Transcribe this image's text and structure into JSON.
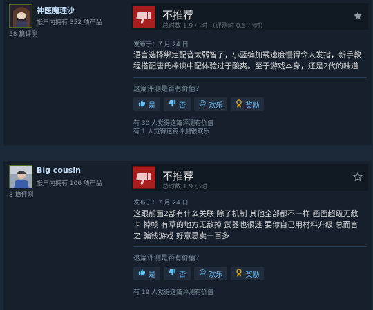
{
  "reviews": [
    {
      "author": {
        "name": "神医魔理沙",
        "products": "帐户内拥有 352 项产品",
        "review_count": "58 篇评测"
      },
      "verdict": "不推荐",
      "hours": "总时数 1.9 小时   （评测时 0.5 小时）",
      "posted": "发布于：7 月 24 日",
      "body": "语言选择绑定配音太弱智了，小蓝编加载速度慢得令人发指，新手教\n程搭配唐氏棒读中配体验过于酸爽。至于游戏本身，还是2代的味道",
      "helpful_question": "这篇评测是否有价值？",
      "buttons": {
        "yes": "是",
        "no": "否",
        "funny": "欢乐",
        "award": "奖励"
      },
      "stats": [
        "有 30 人觉得这篇评测有价值",
        "有 1 人觉得这篇评测很欢乐"
      ],
      "favorited": true
    },
    {
      "author": {
        "name": "Big cousin",
        "products": "帐户内拥有 106 项产品",
        "review_count": "8 篇评测"
      },
      "verdict": "不推荐",
      "hours": "总时数 1.9 小时",
      "posted": "发布于：7 月 24 日",
      "body": "这跟前面2部有什么关联 除了机制 其他全部都不一样 画面超级无敌\n卡 掉帧 有草的地方无敌掉 武器也很迷 要你自己用材料升级 总而言\n之 骗钱游戏 好意思卖一百多",
      "helpful_question": "这篇评测是否有价值？",
      "buttons": {
        "yes": "是",
        "no": "否",
        "funny": "欢乐",
        "award": "奖励"
      },
      "stats": [
        "有 19 人觉得这篇评测有价值"
      ],
      "favorited": false
    }
  ],
  "colors": {
    "thumb_down_bg": "#a61e1e",
    "link_blue": "#67c1f5",
    "award_gold": "#c9a227"
  },
  "icons": [
    "thumbs-down-icon",
    "thumbs-up-icon",
    "smiley-icon",
    "award-icon",
    "star-icon"
  ]
}
